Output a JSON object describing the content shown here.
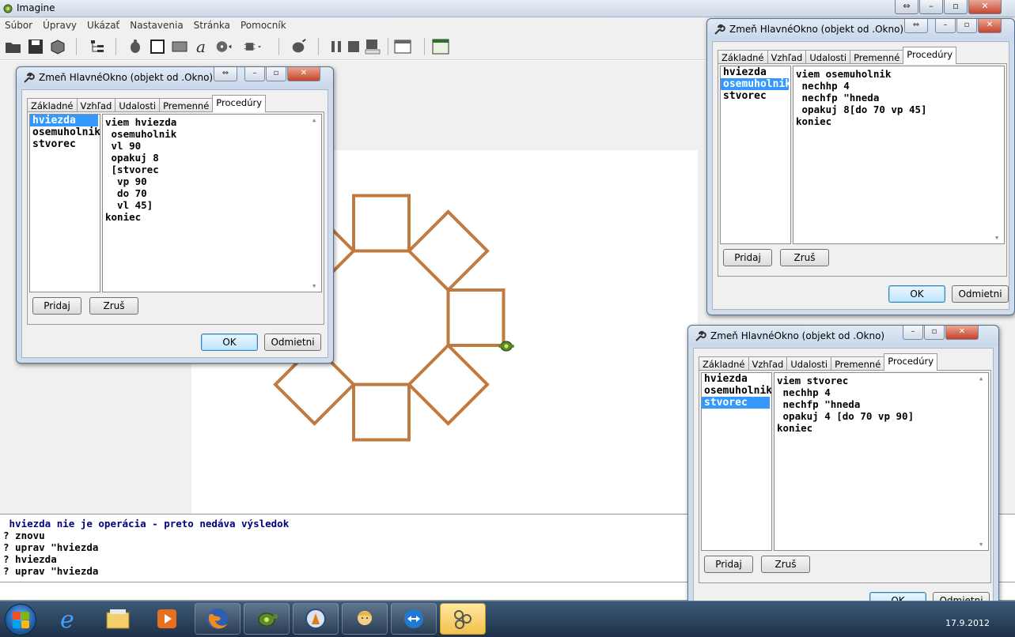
{
  "app": {
    "title": "Imagine",
    "menu": [
      "Súbor",
      "Úpravy",
      "Ukázať",
      "Nastavenia",
      "Stránka",
      "Pomocník"
    ]
  },
  "console": {
    "message": " hviezda nie je operácia - preto nedáva výsledok",
    "lines": [
      "? znovu",
      "? uprav \"hviezda",
      "? hviezda",
      "? uprav \"hviezda"
    ]
  },
  "dialogs": [
    {
      "title": "Zmeň HlavnéOkno (objekt od .Okno)",
      "tabs": [
        "Základné",
        "Vzhľad",
        "Udalosti",
        "Premenné",
        "Procedúry"
      ],
      "active_tab": "Procedúry",
      "procedures": [
        "hviezda",
        "osemuholnik",
        "stvorec"
      ],
      "selected": "hviezda",
      "code": [
        "viem hviezda",
        " osemuholnik",
        " vl 90",
        " opakuj 8",
        " [stvorec",
        "  vp 90",
        "  do 70",
        "  vl 45]",
        "koniec"
      ],
      "add_label": "Pridaj",
      "remove_label": "Zruš",
      "ok_label": "OK",
      "cancel_label": "Odmietni"
    },
    {
      "title": "Zmeň HlavnéOkno (objekt od .Okno)",
      "tabs": [
        "Základné",
        "Vzhľad",
        "Udalosti",
        "Premenné",
        "Procedúry"
      ],
      "active_tab": "Procedúry",
      "procedures": [
        "hviezda",
        "osemuholnik",
        "stvorec"
      ],
      "selected": "osemuholnik",
      "code": [
        "viem osemuholnik",
        " nechhp 4",
        " nechfp \"hneda",
        " opakuj 8[do 70 vp 45]",
        "koniec"
      ],
      "add_label": "Pridaj",
      "remove_label": "Zruš",
      "ok_label": "OK",
      "cancel_label": "Odmietni"
    },
    {
      "title": "Zmeň HlavnéOkno (objekt od .Okno)",
      "tabs": [
        "Základné",
        "Vzhľad",
        "Udalosti",
        "Premenné",
        "Procedúry"
      ],
      "active_tab": "Procedúry",
      "procedures": [
        "hviezda",
        "osemuholnik",
        "stvorec"
      ],
      "selected": "stvorec",
      "code": [
        "viem stvorec",
        " nechhp 4",
        " nechfp \"hneda",
        " opakuj 4 [do 70 vp 90]",
        "koniec"
      ],
      "add_label": "Pridaj",
      "remove_label": "Zruš",
      "ok_label": "OK",
      "cancel_label": "Odmietni"
    }
  ],
  "taskbar": {
    "clock_date": "17.9.2012",
    "apps": [
      "internet-explorer",
      "file-explorer",
      "media-player",
      "firefox",
      "imagine",
      "vlc",
      "user-avatar",
      "teamviewer",
      "imagine-window"
    ]
  },
  "colors": {
    "drawing_stroke": "#c07a40",
    "selection": "#3399ff"
  }
}
